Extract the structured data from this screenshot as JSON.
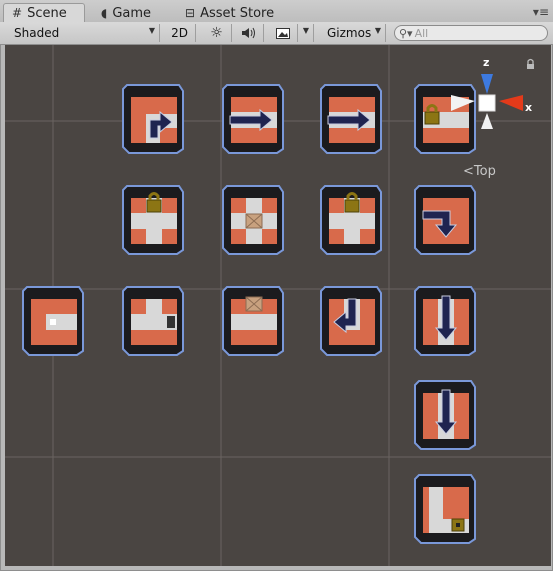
{
  "tabs": [
    {
      "label": "Scene",
      "icon": "grid-icon",
      "active": true
    },
    {
      "label": "Game",
      "icon": "pacman-icon",
      "active": false
    },
    {
      "label": "Asset Store",
      "icon": "store-icon",
      "active": false
    }
  ],
  "toolbar": {
    "draw_mode": "Shaded",
    "mode_2d": "2D",
    "gizmos": "Gizmos"
  },
  "search": {
    "placeholder": "All"
  },
  "gizmo": {
    "x_label": "x",
    "z_label": "z",
    "view_label": "Top"
  },
  "colors": {
    "scene_background": "#4a4542",
    "tile_red": "#d86a4b",
    "tile_dark": "#1b1b1e",
    "tile_outline": "#7a98d9",
    "arrow_navy": "#1f2450",
    "lock_gold": "#8c7514",
    "axis_x": "#e33a1a",
    "axis_z": "#3d7ae0"
  },
  "tiles": [
    {
      "row": 0,
      "col": 1,
      "kind": "corner-arrow"
    },
    {
      "row": 0,
      "col": 2,
      "kind": "arrow-right"
    },
    {
      "row": 0,
      "col": 3,
      "kind": "arrow-right"
    },
    {
      "row": 0,
      "col": 4,
      "kind": "locked-corridor"
    },
    {
      "row": 1,
      "col": 1,
      "kind": "locked-cross"
    },
    {
      "row": 1,
      "col": 2,
      "kind": "crate-cross"
    },
    {
      "row": 1,
      "col": 3,
      "kind": "locked-cross"
    },
    {
      "row": 1,
      "col": 4,
      "kind": "corner-arrow-down"
    },
    {
      "row": 2,
      "col": 0,
      "kind": "dead-end"
    },
    {
      "row": 2,
      "col": 1,
      "kind": "tee"
    },
    {
      "row": 2,
      "col": 2,
      "kind": "crate-corridor"
    },
    {
      "row": 2,
      "col": 3,
      "kind": "arrow-turn"
    },
    {
      "row": 2,
      "col": 4,
      "kind": "arrow-down"
    },
    {
      "row": 3,
      "col": 4,
      "kind": "arrow-down"
    },
    {
      "row": 4,
      "col": 4,
      "kind": "lock-corner"
    }
  ]
}
